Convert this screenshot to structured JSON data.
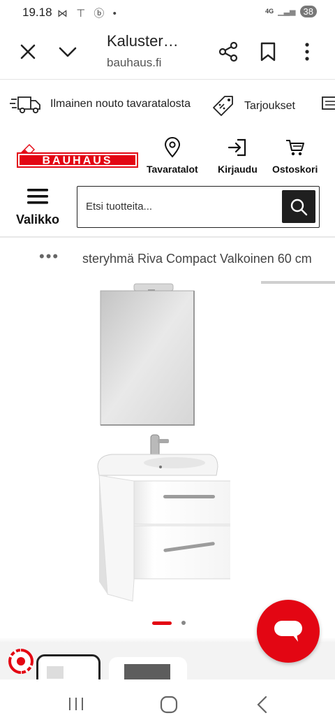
{
  "status_bar": {
    "time": "19.18",
    "left_icons": "⋈ ⊤ ⓑ •",
    "network": "4G",
    "battery": "38"
  },
  "browser": {
    "title": "Kaluster…",
    "url": "bauhaus.fi"
  },
  "promo": {
    "pickup_text": "Ilmainen nouto tavaratalosta",
    "offers_text": "Tarjoukset"
  },
  "header": {
    "logo_text": "BAUHAUS",
    "stores_label": "Tavaratalot",
    "login_label": "Kirjaudu",
    "cart_label": "Ostoskori",
    "menu_label": "Valikko",
    "search_placeholder": "Etsi tuotteita..."
  },
  "breadcrumb": {
    "dots": "•••",
    "current": "steryhmä Riva Compact Valkoinen 60 cm"
  },
  "gallery": {
    "current_index": 1,
    "total": 2
  },
  "colors": {
    "brand_red": "#e30613",
    "dark": "#1f1f1f"
  }
}
